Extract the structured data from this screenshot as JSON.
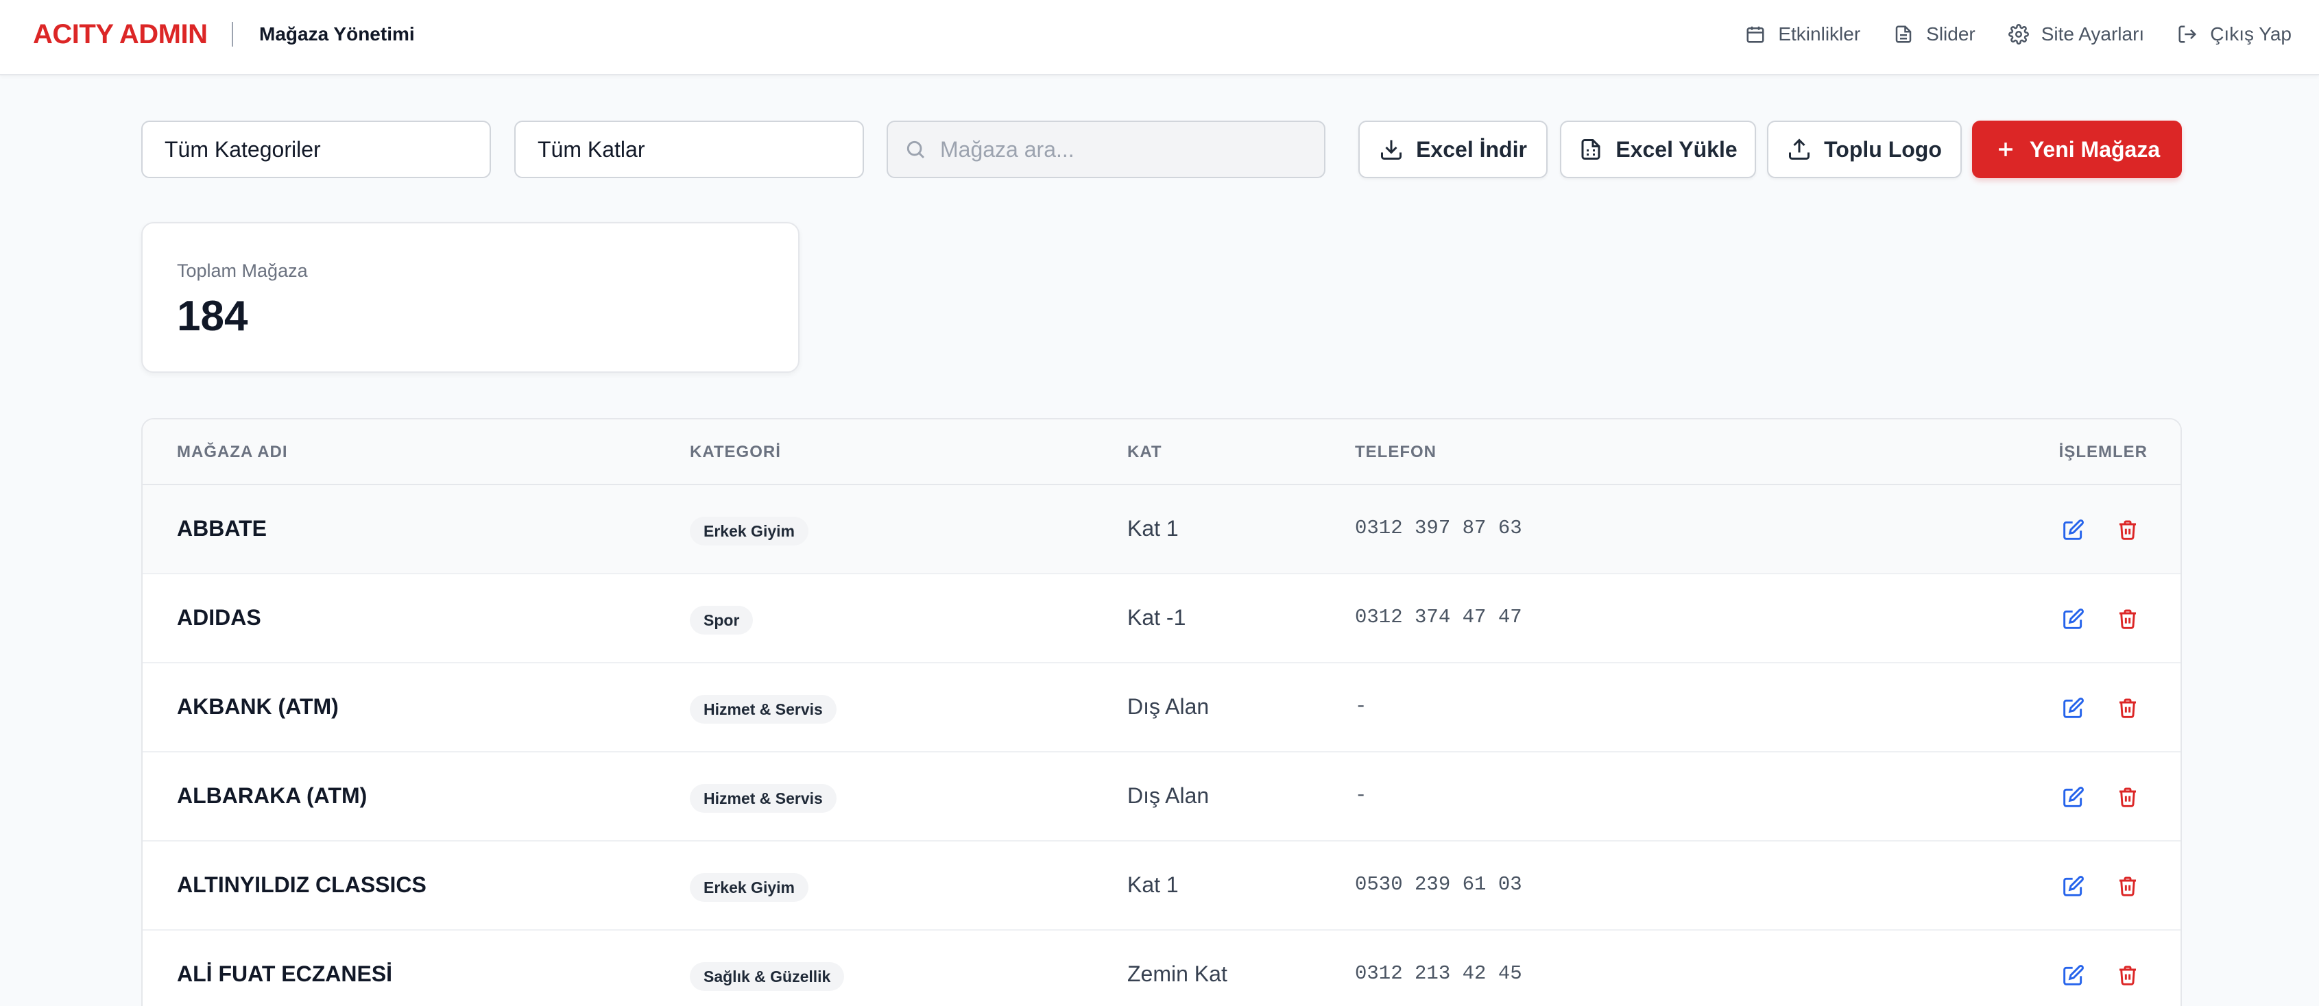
{
  "header": {
    "brand": "ACITY ADMIN",
    "subtitle": "Mağaza Yönetimi",
    "nav": [
      {
        "label": "Etkinlikler",
        "icon": "calendar-icon"
      },
      {
        "label": "Slider",
        "icon": "file-icon"
      },
      {
        "label": "Site Ayarları",
        "icon": "gear-icon"
      },
      {
        "label": "Çıkış Yap",
        "icon": "logout-icon"
      }
    ]
  },
  "toolbar": {
    "category_filter": "Tüm Kategoriler",
    "floor_filter": "Tüm Katlar",
    "search_placeholder": "Mağaza ara...",
    "excel_download": "Excel İndir",
    "excel_upload": "Excel Yükle",
    "bulk_logo": "Toplu Logo",
    "new_store": "Yeni Mağaza"
  },
  "stats": {
    "total_label": "Toplam Mağaza",
    "total_value": "184"
  },
  "table": {
    "headers": {
      "name": "MAĞAZA ADI",
      "category": "KATEGORİ",
      "floor": "KAT",
      "phone": "TELEFON",
      "actions": "İŞLEMLER"
    },
    "rows": [
      {
        "name": "ABBATE",
        "category": "Erkek Giyim",
        "floor": "Kat 1",
        "phone": "0312 397 87 63"
      },
      {
        "name": "ADIDAS",
        "category": "Spor",
        "floor": "Kat -1",
        "phone": "0312 374 47 47"
      },
      {
        "name": "AKBANK (ATM)",
        "category": "Hizmet & Servis",
        "floor": "Dış Alan",
        "phone": "-"
      },
      {
        "name": "ALBARAKA (ATM)",
        "category": "Hizmet & Servis",
        "floor": "Dış Alan",
        "phone": "-"
      },
      {
        "name": "ALTINYILDIZ CLASSICS",
        "category": "Erkek Giyim",
        "floor": "Kat 1",
        "phone": "0530 239 61 03"
      },
      {
        "name": "ALİ FUAT ECZANESİ",
        "category": "Sağlık & Güzellik",
        "floor": "Zemin Kat",
        "phone": "0312 213 42 45"
      }
    ]
  },
  "colors": {
    "brand": "#dc2626",
    "edit": "#2563eb",
    "delete": "#dc2626"
  }
}
